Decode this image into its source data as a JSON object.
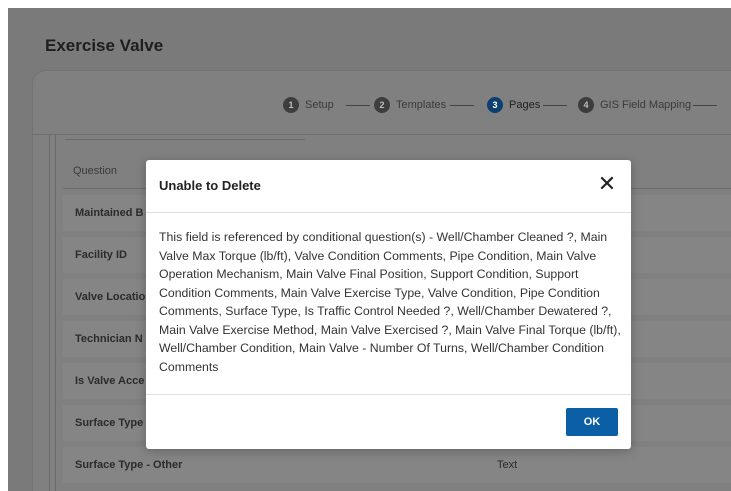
{
  "page": {
    "title": "Exercise Valve"
  },
  "stepper": {
    "steps": [
      {
        "num": "1",
        "label": "Setup"
      },
      {
        "num": "2",
        "label": "Templates"
      },
      {
        "num": "3",
        "label": "Pages",
        "active": true
      },
      {
        "num": "4",
        "label": "GIS Field Mapping"
      }
    ]
  },
  "table": {
    "header": "Question",
    "rows": [
      {
        "question": "Maintained B",
        "type": ""
      },
      {
        "question": "Facility ID",
        "type": ""
      },
      {
        "question": "Valve Locatio",
        "type": ""
      },
      {
        "question": "Technician N",
        "type": ""
      },
      {
        "question": "Is Valve Acce",
        "type": ""
      },
      {
        "question": "Surface Type",
        "type": ""
      },
      {
        "question": "Surface Type - Other",
        "type": "Text"
      }
    ]
  },
  "modal": {
    "title": "Unable to Delete",
    "close_glyph": "✕",
    "message": "This field is referenced by conditional question(s) - Well/Chamber Cleaned ?, Main Valve Max Torque (lb/ft), Valve Condition Comments, Pipe Condition, Main Valve Operation Mechanism, Main Valve Final Position, Support Condition, Support Condition Comments, Main Valve Exercise Type, Valve Condition, Pipe Condition Comments, Surface Type, Is Traffic Control Needed ?, Well/Chamber Dewatered ?, Main Valve Exercise Method, Main Valve Exercised ?, Main Valve Final Torque (lb/ft), Well/Chamber Condition, Main Valve - Number Of Turns, Well/Chamber Condition Comments",
    "ok_label": "OK"
  },
  "colors": {
    "primary": "#0b5fa5",
    "active_step": "#0c3f6e",
    "overlay": "#7a7a7a"
  }
}
